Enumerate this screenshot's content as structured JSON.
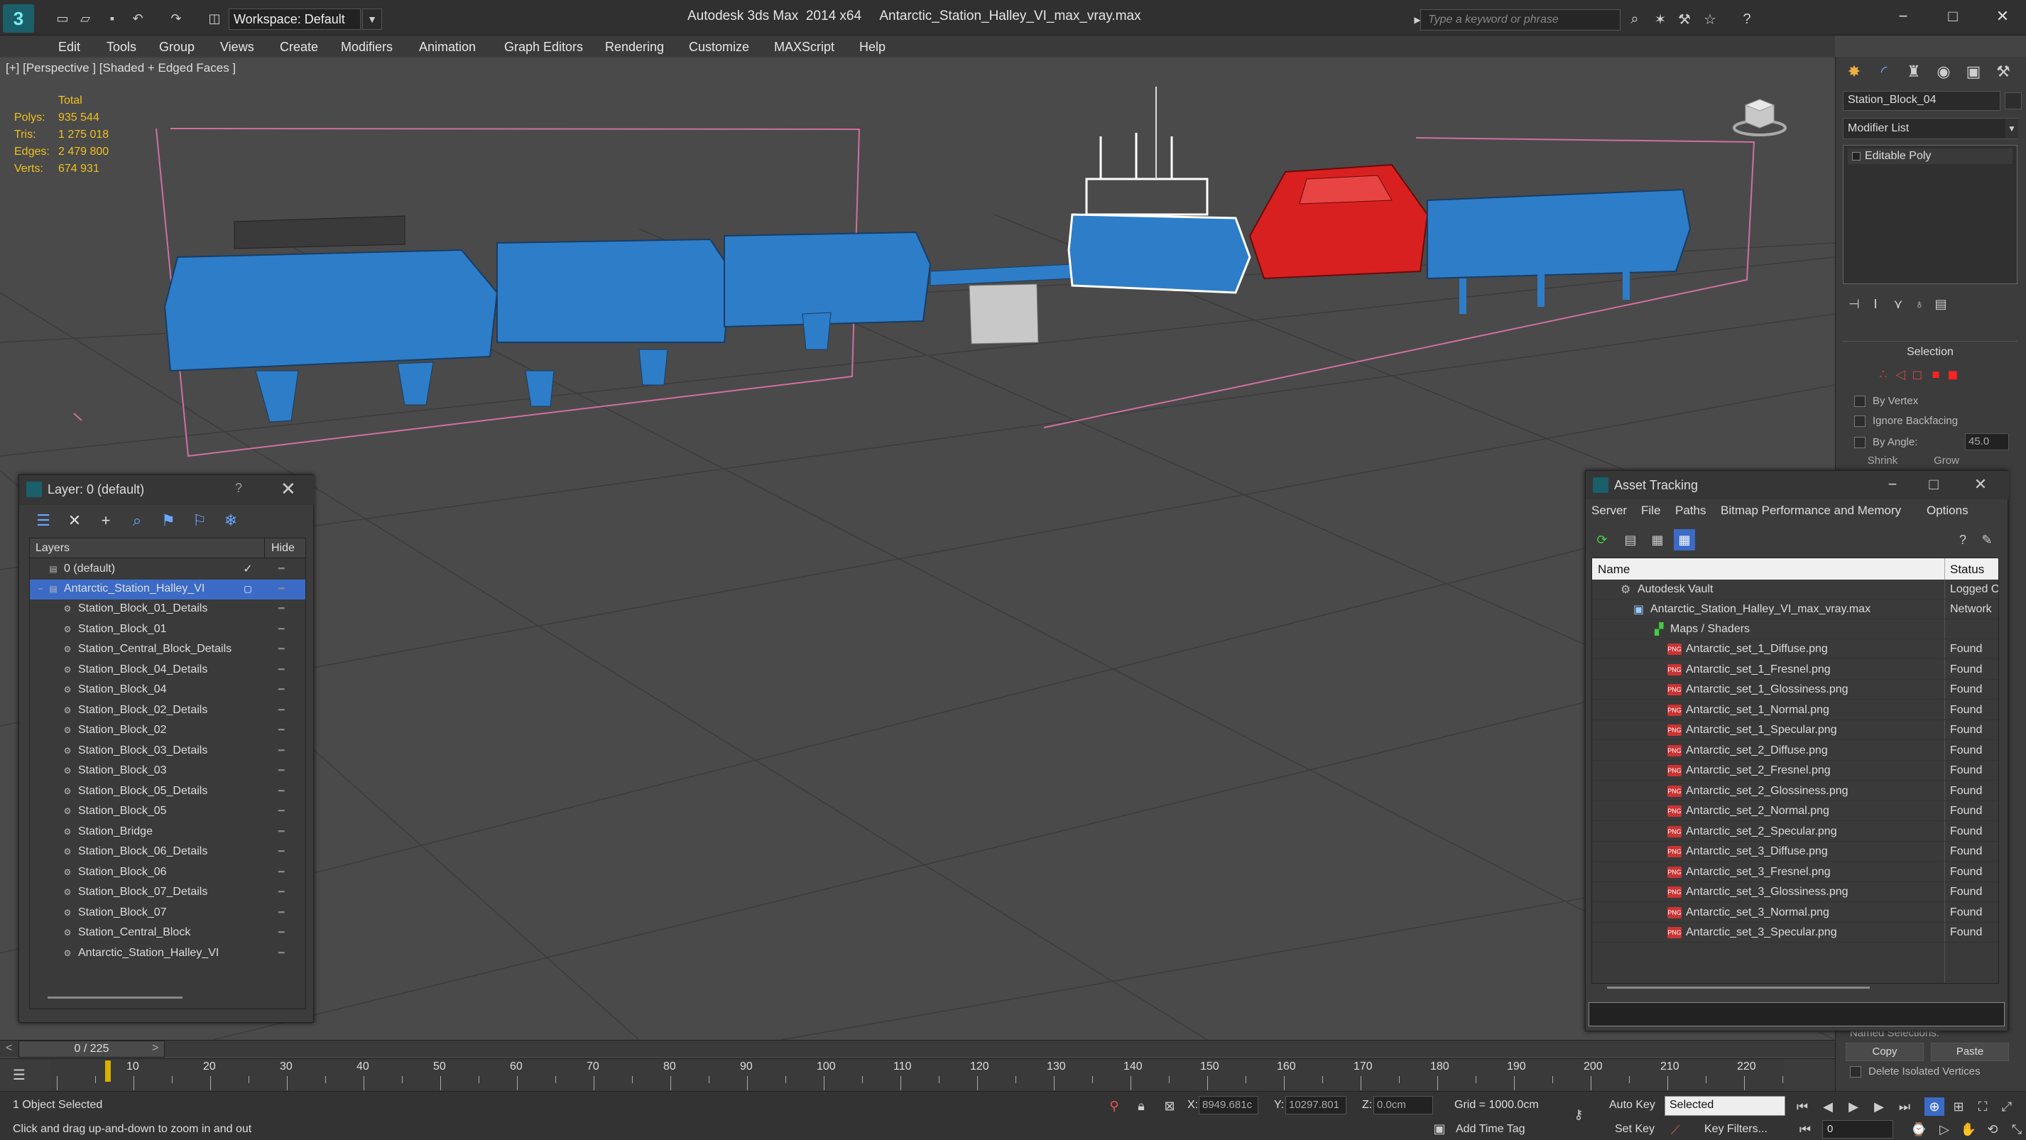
{
  "app": {
    "title": "Autodesk 3ds Max  2014 x64     Antarctic_Station_Halley_VI_max_vray.max",
    "workspace": "Workspace: Default",
    "search_placeholder": "Type a keyword or phrase"
  },
  "menu": [
    "Edit",
    "Tools",
    "Group",
    "Views",
    "Create",
    "Modifiers",
    "Animation",
    "Graph Editors",
    "Rendering",
    "Customize",
    "MAXScript",
    "Help"
  ],
  "viewport": {
    "label": "[+] [Perspective ] [Shaded + Edged Faces ]",
    "stats": {
      "header": "Total",
      "rows": [
        {
          "k": "Polys:",
          "v": "935 544"
        },
        {
          "k": "Tris:",
          "v": "1 275 018"
        },
        {
          "k": "Edges:",
          "v": "2 479 800"
        },
        {
          "k": "Verts:",
          "v": "674 931"
        }
      ]
    }
  },
  "command_panel": {
    "object_name": "Station_Block_04",
    "modifier_list": "Modifier List",
    "modifier_item": "Editable Poly",
    "selection_title": "Selection",
    "by_vertex": "By Vertex",
    "ignore_backfacing": "Ignore Backfacing",
    "by_angle": "By Angle:",
    "angle_value": "45.0",
    "shrink": "Shrink",
    "grow": "Grow",
    "named_selections": "Named Selections:",
    "copy": "Copy",
    "paste": "Paste",
    "delete_isolated": "Delete Isolated Vertices"
  },
  "layer_window": {
    "title": "Layer: 0 (default)",
    "help": "?",
    "col_layers": "Layers",
    "col_hide": "Hide",
    "default_layer": "0 (default)",
    "selected_layer": "Antarctic_Station_Halley_VI",
    "objects": [
      "Station_Block_01_Details",
      "Station_Block_01",
      "Station_Central_Block_Details",
      "Station_Block_04_Details",
      "Station_Block_04",
      "Station_Block_02_Details",
      "Station_Block_02",
      "Station_Block_03_Details",
      "Station_Block_03",
      "Station_Block_05_Details",
      "Station_Block_05",
      "Station_Bridge",
      "Station_Block_06_Details",
      "Station_Block_06",
      "Station_Block_07_Details",
      "Station_Block_07",
      "Station_Central_Block",
      "Antarctic_Station_Halley_VI"
    ]
  },
  "asset_window": {
    "title": "Asset Tracking",
    "menu": [
      "Server",
      "File",
      "Paths",
      "Bitmap Performance and Memory",
      "Options"
    ],
    "col_name": "Name",
    "col_status": "Status",
    "vault": {
      "name": "Autodesk Vault",
      "status": "Logged O"
    },
    "file": {
      "name": "Antarctic_Station_Halley_VI_max_vray.max",
      "status": "Network"
    },
    "group": "Maps / Shaders",
    "maps": [
      {
        "name": "Antarctic_set_1_Diffuse.png",
        "status": "Found"
      },
      {
        "name": "Antarctic_set_1_Fresnel.png",
        "status": "Found"
      },
      {
        "name": "Antarctic_set_1_Glossiness.png",
        "status": "Found"
      },
      {
        "name": "Antarctic_set_1_Normal.png",
        "status": "Found"
      },
      {
        "name": "Antarctic_set_1_Specular.png",
        "status": "Found"
      },
      {
        "name": "Antarctic_set_2_Diffuse.png",
        "status": "Found"
      },
      {
        "name": "Antarctic_set_2_Fresnel.png",
        "status": "Found"
      },
      {
        "name": "Antarctic_set_2_Glossiness.png",
        "status": "Found"
      },
      {
        "name": "Antarctic_set_2_Normal.png",
        "status": "Found"
      },
      {
        "name": "Antarctic_set_2_Specular.png",
        "status": "Found"
      },
      {
        "name": "Antarctic_set_3_Diffuse.png",
        "status": "Found"
      },
      {
        "name": "Antarctic_set_3_Fresnel.png",
        "status": "Found"
      },
      {
        "name": "Antarctic_set_3_Glossiness.png",
        "status": "Found"
      },
      {
        "name": "Antarctic_set_3_Normal.png",
        "status": "Found"
      },
      {
        "name": "Antarctic_set_3_Specular.png",
        "status": "Found"
      }
    ]
  },
  "timeline": {
    "position": "0 / 225",
    "left": "<",
    "right": ">"
  },
  "ruler": [
    "10",
    "20",
    "30",
    "40",
    "50",
    "60",
    "70",
    "80",
    "90",
    "100",
    "110",
    "120",
    "130",
    "140",
    "150",
    "160",
    "170",
    "180",
    "190",
    "200",
    "210",
    "220"
  ],
  "status": {
    "selection": "1 Object Selected",
    "prompt": "Click and drag up-and-down to zoom in and out",
    "x_label": "X:",
    "x": "8949.681c",
    "y_label": "Y:",
    "y": "10297.801",
    "z_label": "Z:",
    "z": "0.0cm",
    "grid": "Grid = 1000.0cm",
    "add_time_tag": "Add Time Tag",
    "auto_key": "Auto Key",
    "set_key": "Set Key",
    "selected": "Selected",
    "key_filters": "Key Filters...",
    "frame": "0"
  },
  "colors": {
    "station_blue": "#2e7dc8",
    "station_red": "#d92020",
    "selection": "#3b6bc6",
    "stats": "#f0c020"
  }
}
